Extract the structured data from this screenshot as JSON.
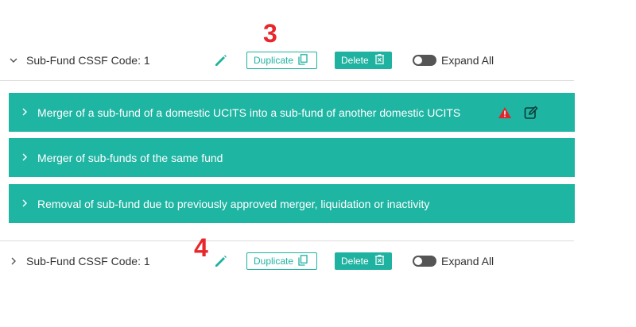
{
  "annotations": {
    "first": "3",
    "second": "4"
  },
  "subfunds": [
    {
      "title": "Sub-Fund CSSF Code: 1",
      "duplicate_label": "Duplicate",
      "delete_label": "Delete",
      "expand_label": "Expand All",
      "expanded": true
    },
    {
      "title": "Sub-Fund CSSF Code: 1",
      "duplicate_label": "Duplicate",
      "delete_label": "Delete",
      "expand_label": "Expand All",
      "expanded": false
    }
  ],
  "sections": [
    {
      "label": "Merger of a sub-fund of a domestic UCITS into a sub-fund of another domestic UCITS",
      "has_warning": true,
      "has_edit": true
    },
    {
      "label": "Merger of sub-funds of the same fund"
    },
    {
      "label": "Removal of sub-fund due to previously approved merger, liquidation or inactivity"
    }
  ],
  "colors": {
    "accent": "#1fb5a3",
    "annotation": "#e8262b",
    "warning": "#e0262b",
    "toggle_off": "#555555"
  },
  "icons": {
    "collapse": "chevron-down-icon",
    "expand": "chevron-right-icon",
    "edit": "pencil-icon",
    "duplicate": "copy-icon",
    "delete": "trash-icon",
    "warning": "warning-icon",
    "edit_section": "edit-square-icon"
  }
}
